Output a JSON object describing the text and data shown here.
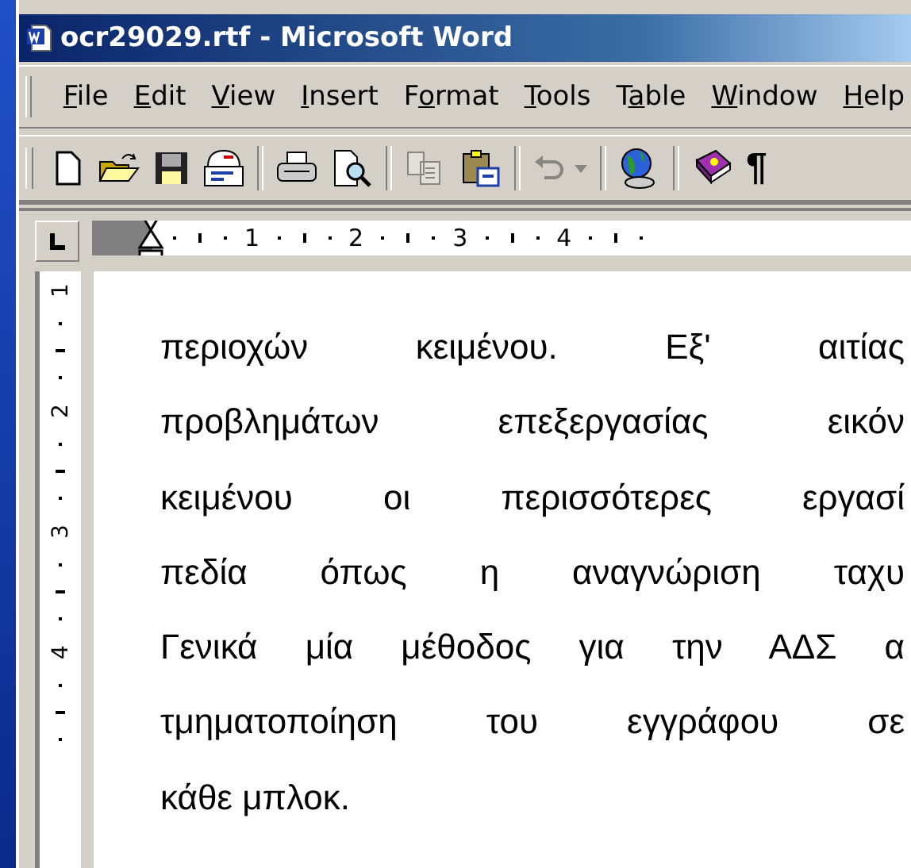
{
  "window": {
    "title": "ocr29029.rtf - Microsoft Word"
  },
  "menu": [
    {
      "access_key": "F",
      "label_end": "ile"
    },
    {
      "access_key": "E",
      "label_end": "dit"
    },
    {
      "access_key": "V",
      "label_end": "iew"
    },
    {
      "access_key": "I",
      "label_end": "nsert"
    },
    {
      "label_start": "F",
      "access_key": "o",
      "label_end": "rmat"
    },
    {
      "access_key": "T",
      "label_end": "ools"
    },
    {
      "label_start": "T",
      "access_key": "a",
      "label_end": "ble"
    },
    {
      "access_key": "W",
      "label_end": "indow"
    },
    {
      "access_key": "H",
      "label_end": "elp"
    }
  ],
  "toolbar": [
    {
      "kind": "new",
      "disabled": false
    },
    {
      "kind": "open",
      "disabled": false
    },
    {
      "kind": "save",
      "disabled": false
    },
    {
      "kind": "mail",
      "disabled": false
    },
    {
      "kind": "sep"
    },
    {
      "kind": "print",
      "disabled": false
    },
    {
      "kind": "preview",
      "disabled": false
    },
    {
      "kind": "sep"
    },
    {
      "kind": "copy",
      "disabled": true
    },
    {
      "kind": "paste",
      "disabled": false
    },
    {
      "kind": "sep"
    },
    {
      "kind": "undo",
      "disabled": true
    },
    {
      "kind": "sep"
    },
    {
      "kind": "web",
      "disabled": false
    },
    {
      "kind": "sep"
    },
    {
      "kind": "help",
      "disabled": false
    },
    {
      "kind": "pilcrow",
      "text": "¶",
      "disabled": false
    }
  ],
  "ruler": {
    "numbers": [
      "1",
      "2",
      "3",
      "4"
    ],
    "vertical_numbers": [
      "1",
      "2",
      "3",
      "4"
    ]
  },
  "document": {
    "lines": [
      {
        "text": "περιοχών κειμένου. Εξ' αιτίας",
        "kind": "justified"
      },
      {
        "text": "προβλημάτων επεξεργασίας εικόν",
        "kind": "justified"
      },
      {
        "text": "κειμένου οι περισσότερες εργασί",
        "kind": "justified"
      },
      {
        "text": "πεδία όπως η αναγνώριση ταχυ",
        "kind": "justified"
      },
      {
        "text": "Γενικά μία μέθοδος για την ΑΔΣ α",
        "kind": "justified"
      },
      {
        "text": "τμηματοποίηση του εγγράφου σε",
        "kind": "justified"
      },
      {
        "text": "κάθε μπλοκ.",
        "kind": "last"
      }
    ]
  }
}
